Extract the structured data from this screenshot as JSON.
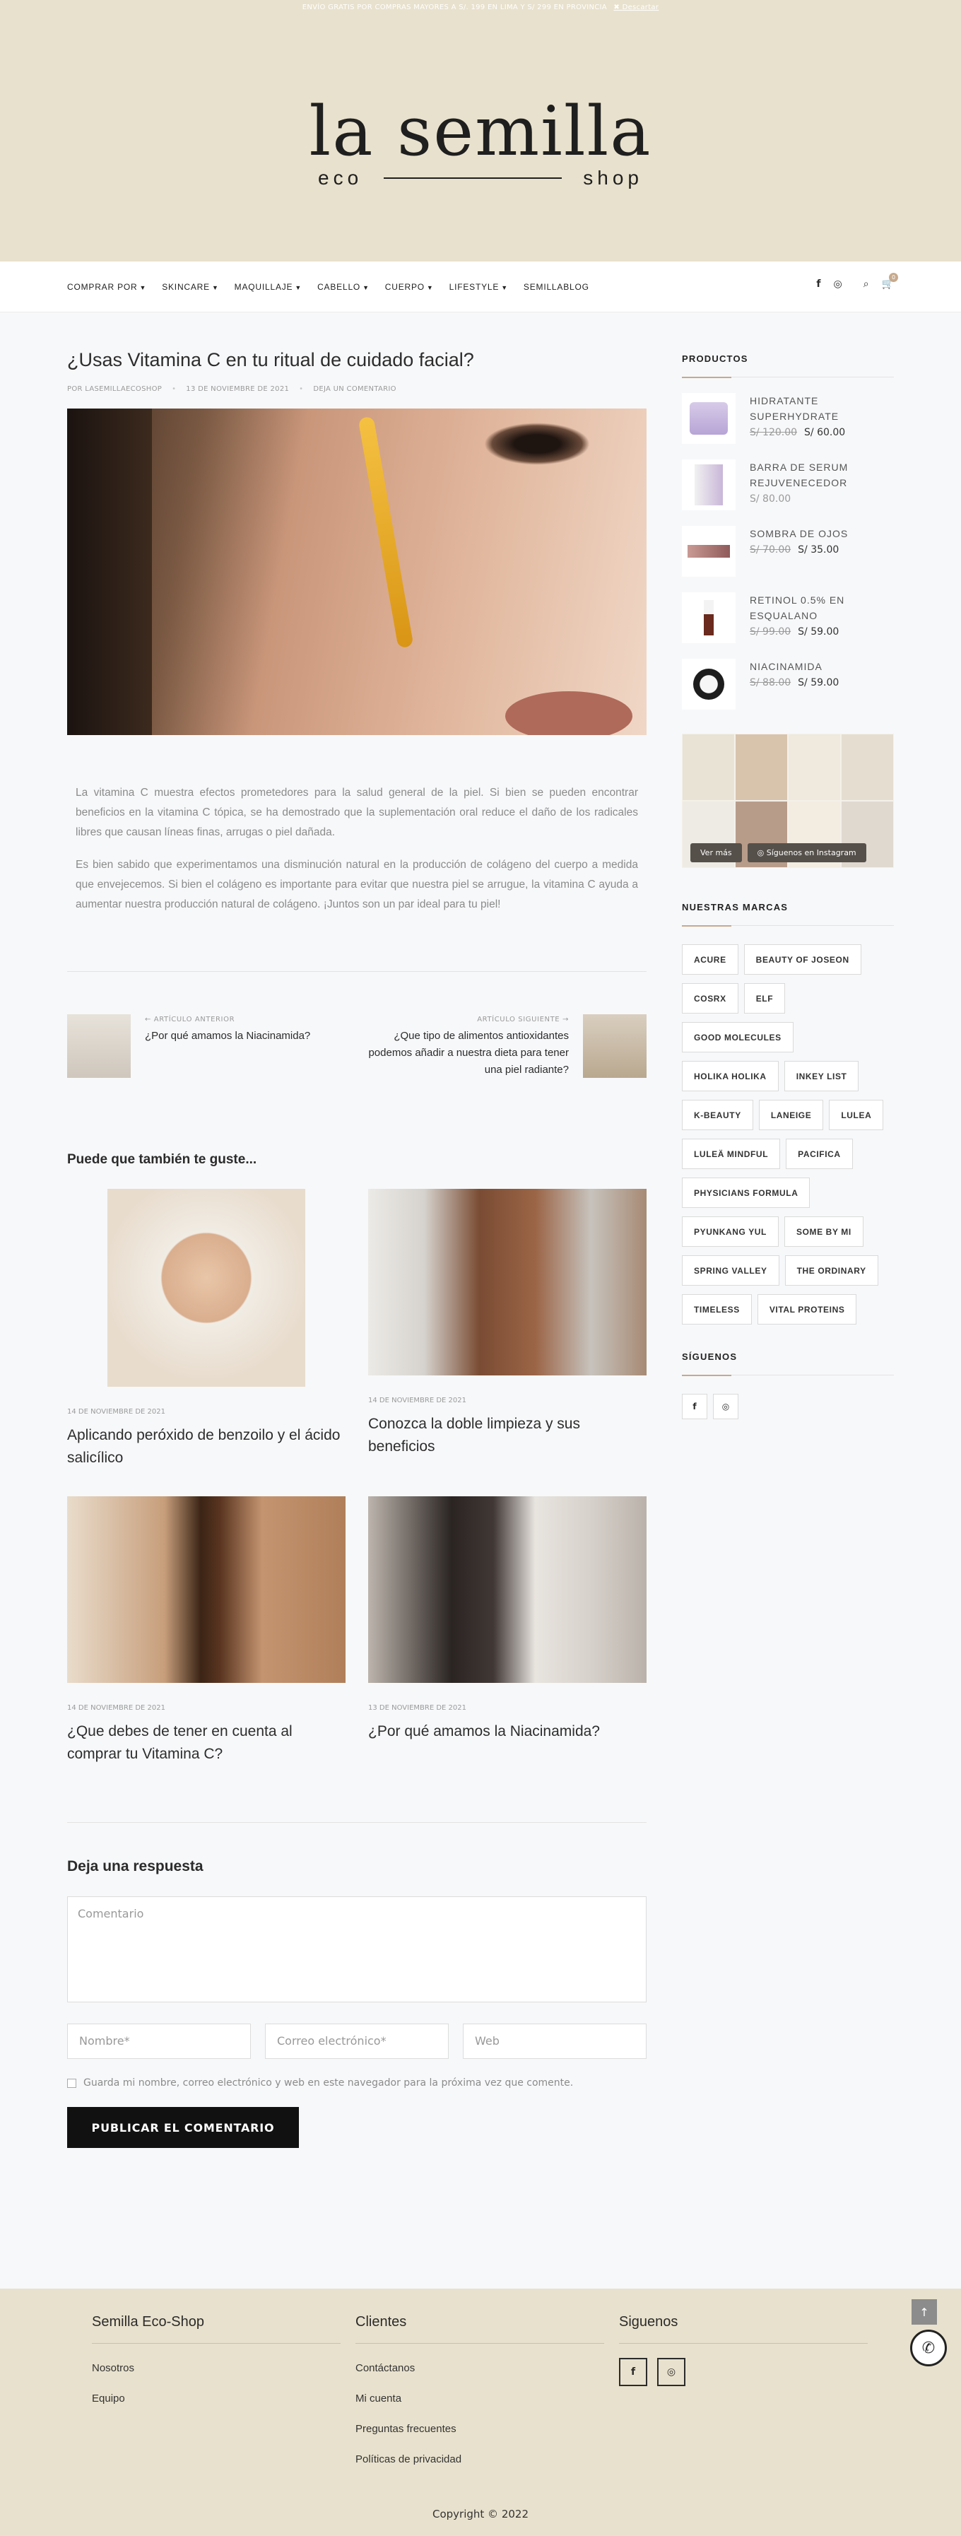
{
  "topbar": {
    "text": "ENVÍO GRATIS POR COMPRAS MAYORES A S/. 199 EN LIMA Y S/ 299 EN PROVINCIA",
    "dismiss": "Descartar"
  },
  "logo": {
    "main": "la semilla",
    "left": "eco",
    "right": "shop"
  },
  "nav": {
    "items": [
      "COMPRAR POR",
      "SKINCARE",
      "MAQUILLAJE",
      "CABELLO",
      "CUERPO",
      "LIFESTYLE",
      "SEMILLABLOG"
    ],
    "cart_count": "0"
  },
  "post": {
    "title": "¿Usas Vitamina C en tu ritual de cuidado facial?",
    "author": "POR LASEMILLAECOSHOP",
    "date": "13 DE NOVIEMBRE DE 2021",
    "comment": "DEJA UN COMENTARIO",
    "paragraphs": [
      "La vitamina C muestra efectos prometedores para la salud general de la piel. Si bien se pueden encontrar beneficios en la vitamina C tópica, se ha demostrado que la suplementación oral reduce el daño de los radicales libres que causan líneas finas, arrugas o piel dañada.",
      "Es bien sabido que experimentamos una disminución natural en la producción de colágeno del cuerpo a medida que envejecemos. Si bien el colágeno es importante para evitar que nuestra piel se arrugue, la vitamina C ayuda a aumentar nuestra producción natural de colágeno. ¡Juntos son un par ideal para tu piel!"
    ]
  },
  "postnav": {
    "prev_label": "ARTÍCULO ANTERIOR",
    "prev_title": "¿Por qué amamos la Niacinamida?",
    "next_label": "ARTÍCULO SIGUIENTE",
    "next_title": "¿Que tipo de alimentos antioxidantes podemos añadir a nuestra dieta para tener una piel radiante?"
  },
  "related": {
    "heading": "Puede que también te guste...",
    "cards": [
      {
        "date": "14 DE NOVIEMBRE DE 2021",
        "title": "Aplicando peróxido de benzoilo y el ácido salicílico"
      },
      {
        "date": "14 DE NOVIEMBRE DE 2021",
        "title": "Conozca la doble limpieza y sus beneficios"
      },
      {
        "date": "14 DE NOVIEMBRE DE 2021",
        "title": "¿Que debes de tener en cuenta al comprar tu Vitamina C?"
      },
      {
        "date": "13 DE NOVIEMBRE DE 2021",
        "title": "¿Por qué amamos la Niacinamida?"
      }
    ]
  },
  "reply": {
    "heading": "Deja una respuesta",
    "comment_ph": "Comentario",
    "name_ph": "Nombre*",
    "email_ph": "Correo electrónico*",
    "web_ph": "Web",
    "save_label": "Guarda mi nombre, correo electrónico y web en este navegador para la próxima vez que comente.",
    "submit": "PUBLICAR EL COMENTARIO"
  },
  "sidebar": {
    "products_title": "PRODUCTOS",
    "products": [
      {
        "name": "HIDRATANTE SUPERHYDRATE",
        "old": "S/ 120.00",
        "price": "S/ 60.00"
      },
      {
        "name": "BARRA DE SERUM REJUVENECEDOR",
        "old": "",
        "price": "S/ 80.00"
      },
      {
        "name": "SOMBRA DE OJOS",
        "old": "S/ 70.00",
        "price": "S/ 35.00"
      },
      {
        "name": "RETINOL 0.5% EN ESQUALANO",
        "old": "S/ 99.00",
        "price": "S/ 59.00"
      },
      {
        "name": "NIACINAMIDA",
        "old": "S/ 88.00",
        "price": "S/ 59.00"
      }
    ],
    "insta_more": "Ver más",
    "insta_follow": "Síguenos en Instagram",
    "brands_title": "NUESTRAS MARCAS",
    "brands": [
      "ACURE",
      "BEAUTY OF JOSEON",
      "COSRX",
      "ELF",
      "GOOD MOLECULES",
      "HOLIKA HOLIKA",
      "INKEY LIST",
      "K-BEAUTY",
      "LANEIGE",
      "LULEA",
      "LULEÄ MINDFUL",
      "PACIFICA",
      "PHYSICIANS FORMULA",
      "PYUNKANG YUL",
      "SOME BY MI",
      "SPRING VALLEY",
      "THE ORDINARY",
      "TIMELESS",
      "VITAL PROTEINS"
    ],
    "follow_title": "SÍGUENOS"
  },
  "footer": {
    "col1_title": "Semilla Eco-Shop",
    "col1_links": [
      "Nosotros",
      "Equipo"
    ],
    "col2_title": "Clientes",
    "col2_links": [
      "Contáctanos",
      "Mi cuenta",
      "Preguntas frecuentes",
      "Políticas de privacidad"
    ],
    "col3_title": "Siguenos",
    "copyright": "Copyright © 2022"
  },
  "colors": {
    "beige": "#e8e1cd",
    "accent": "#c8a98c",
    "dark": "#111111"
  }
}
